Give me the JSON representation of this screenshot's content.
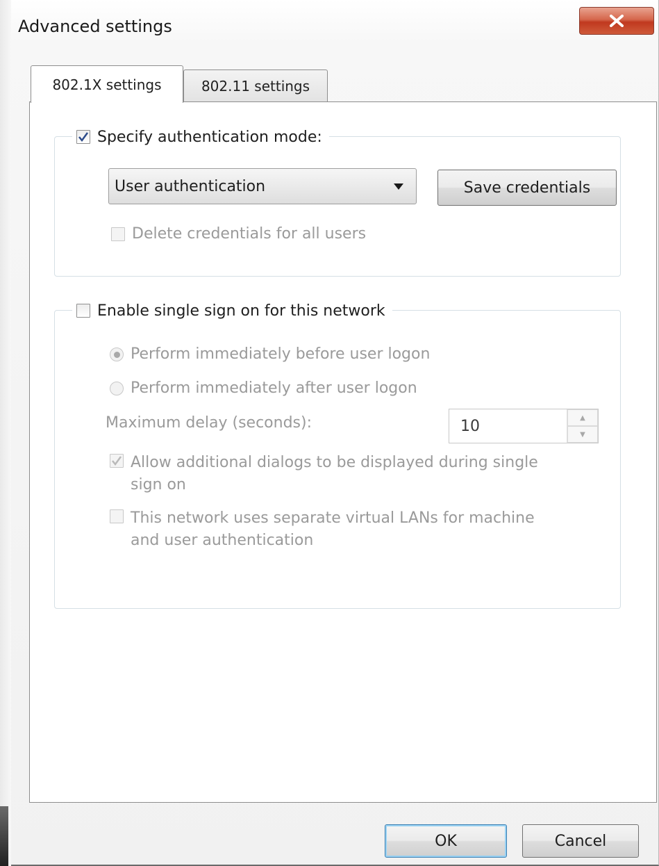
{
  "window": {
    "title": "Advanced settings",
    "close_icon": "close-x-icon"
  },
  "tabs": [
    {
      "label": "802.1X settings",
      "selected": true
    },
    {
      "label": "802.11 settings",
      "selected": false
    }
  ],
  "auth_group": {
    "specify_auth_mode": {
      "label": "Specify authentication mode:",
      "checked": true
    },
    "auth_mode_select": {
      "value": "User authentication"
    },
    "save_credentials_label": "Save credentials",
    "delete_credentials": {
      "label": "Delete credentials for all users",
      "checked": false,
      "enabled": false
    }
  },
  "sso_group": {
    "enable_sso": {
      "label": "Enable single sign on for this network",
      "checked": false
    },
    "radio_before": {
      "label": "Perform immediately before user logon",
      "selected": true,
      "enabled": false
    },
    "radio_after": {
      "label": "Perform immediately after user logon",
      "selected": false,
      "enabled": false
    },
    "max_delay_label": "Maximum delay (seconds):",
    "max_delay_value": "10",
    "allow_dialogs": {
      "label_line1": "Allow additional dialogs to be displayed during single",
      "label_line2": "sign on",
      "checked": true,
      "enabled": false
    },
    "separate_vlans": {
      "label_line1": "This network uses separate virtual LANs for machine",
      "label_line2": "and user authentication",
      "checked": false,
      "enabled": false
    }
  },
  "footer": {
    "ok_label": "OK",
    "cancel_label": "Cancel"
  },
  "colors": {
    "close_button": "#c0391f",
    "checkmark": "#2b4a8a",
    "disabled_text": "#9a9a9a",
    "group_border": "#d5dfe5"
  }
}
